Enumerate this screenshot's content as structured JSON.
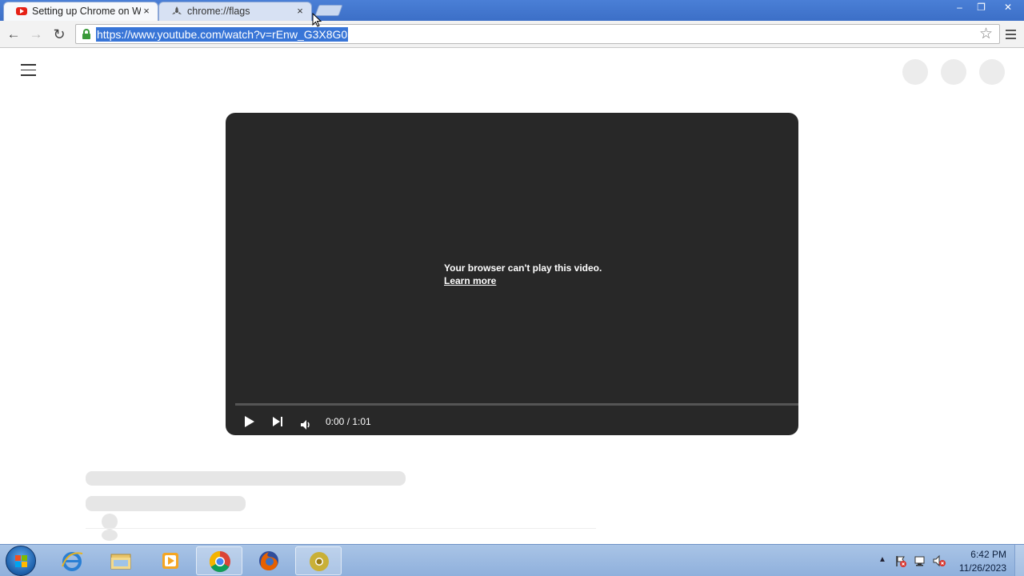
{
  "browser": {
    "tabs": [
      {
        "title": "Setting up Chrome on Wi",
        "favicon": "youtube-icon",
        "active": true
      },
      {
        "title": "chrome://flags",
        "favicon": "flask-icon",
        "active": false
      }
    ],
    "tab_close_glyph": "×",
    "window_controls": {
      "minimize": "–",
      "maximize": "❐",
      "close": "✕"
    },
    "toolbar": {
      "back_icon": "←",
      "forward_icon": "→",
      "reload_icon": "↻",
      "url": "https://www.youtube.com/watch?v=rEnw_G3X8G0",
      "bookmark_icon": "☆",
      "secure": true
    }
  },
  "page": {
    "player": {
      "error_message": "Your browser can't play this video.",
      "learn_more": "Learn more",
      "time": "0:00 / 1:01",
      "progress": 0
    }
  },
  "taskbar": {
    "apps": [
      "internet-explorer",
      "windows-explorer",
      "media-player",
      "chrome",
      "firefox",
      "chrome-canary"
    ],
    "tray": {
      "arrow": "▲",
      "time": "6:42 PM",
      "date": "11/26/2023"
    }
  },
  "colors": {
    "url_highlight": "#3875d7",
    "player_bg": "#282828",
    "secure_green": "#3a9a3a",
    "youtube_red": "#e62117"
  }
}
